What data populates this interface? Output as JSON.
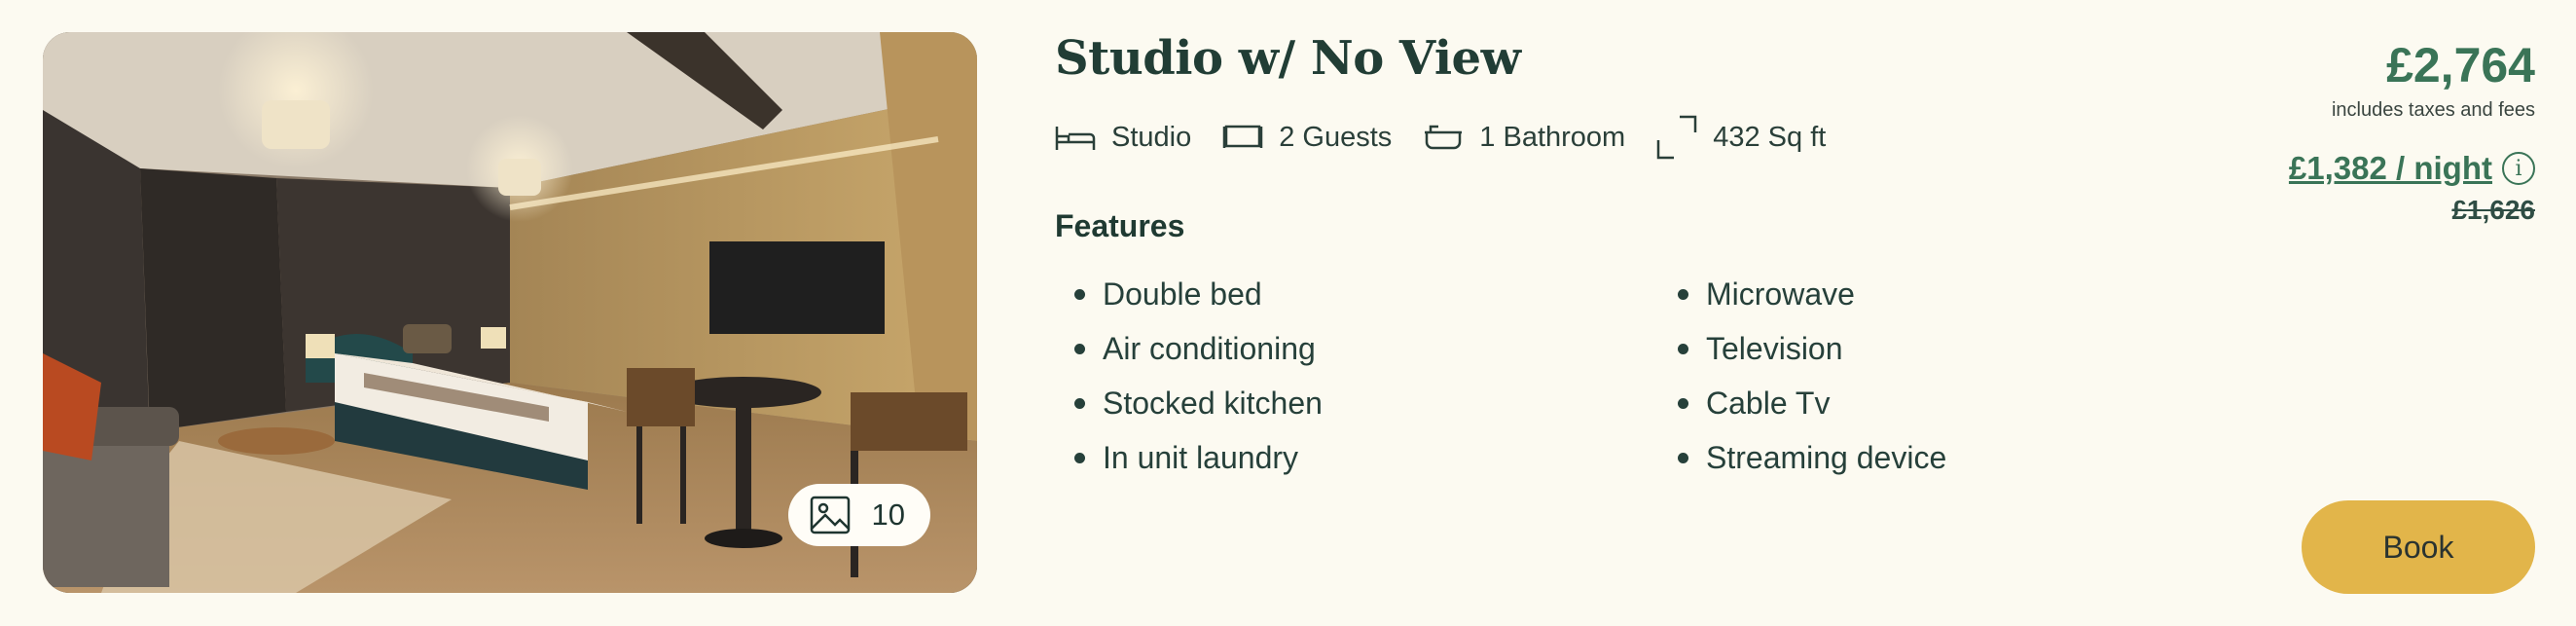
{
  "listing": {
    "title": "Studio w/ No View",
    "photo_count": "10",
    "specs": [
      {
        "icon": "bed-icon",
        "label": "Studio"
      },
      {
        "icon": "guests-icon",
        "label": "2 Guests"
      },
      {
        "icon": "bathtub-icon",
        "label": "1 Bathroom"
      },
      {
        "icon": "area-icon",
        "label": "432 Sq ft"
      }
    ],
    "features_heading": "Features",
    "features_left": [
      "Double bed",
      "Air conditioning",
      "Stocked kitchen",
      "In unit laundry"
    ],
    "features_right": [
      "Microwave",
      "Television",
      "Cable Tv",
      "Streaming device"
    ]
  },
  "pricing": {
    "total": "£2,764",
    "note": "includes taxes and fees",
    "per_night": "£1,382 / night",
    "original": "£1,626",
    "info_icon": "info-icon"
  },
  "actions": {
    "book_label": "Book"
  },
  "colors": {
    "background": "#fcfaf1",
    "accent_green": "#3a7457",
    "button": "#e2b54a",
    "text": "#1f3a32"
  }
}
